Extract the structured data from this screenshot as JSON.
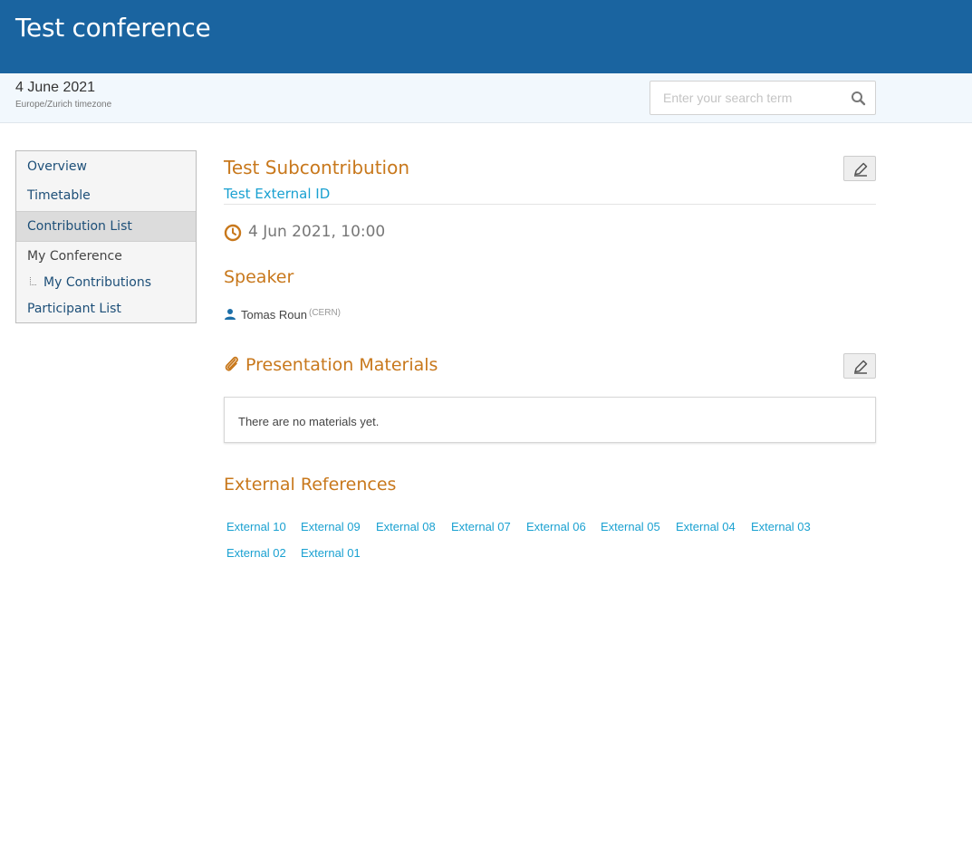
{
  "header": {
    "title": "Test conference"
  },
  "subheader": {
    "date": "4 June 2021",
    "timezone": "Europe/Zurich timezone",
    "search_placeholder": "Enter your search term"
  },
  "menu": {
    "items": [
      {
        "label": "Overview"
      },
      {
        "label": "Timetable"
      },
      {
        "label": "Contribution List",
        "active": true
      },
      {
        "label": "My Conference"
      },
      {
        "label": "My Contributions"
      },
      {
        "label": "Participant List"
      }
    ]
  },
  "contribution": {
    "title": "Test Subcontribution",
    "external_id": "Test External ID",
    "datetime": "4 Jun 2021, 10:00",
    "speaker_heading": "Speaker",
    "speaker_name": "Tomas Roun",
    "speaker_affiliation": "(CERN)",
    "materials_heading": "Presentation Materials",
    "materials_empty": "There are no materials yet.",
    "references_heading": "External References",
    "references": [
      "External 10",
      "External 09",
      "External 08",
      "External 07",
      "External 06",
      "External 05",
      "External 04",
      "External 03",
      "External 02",
      "External 01"
    ]
  },
  "colors": {
    "header_bg": "#1a64a0",
    "accent_orange": "#c8781c",
    "link_blue": "#1aa1d1",
    "menu_text": "#1d4f78"
  },
  "icons": [
    "search-icon",
    "edit-icon",
    "clock-icon",
    "person-icon",
    "paperclip-icon",
    "tree-branch-icon"
  ]
}
